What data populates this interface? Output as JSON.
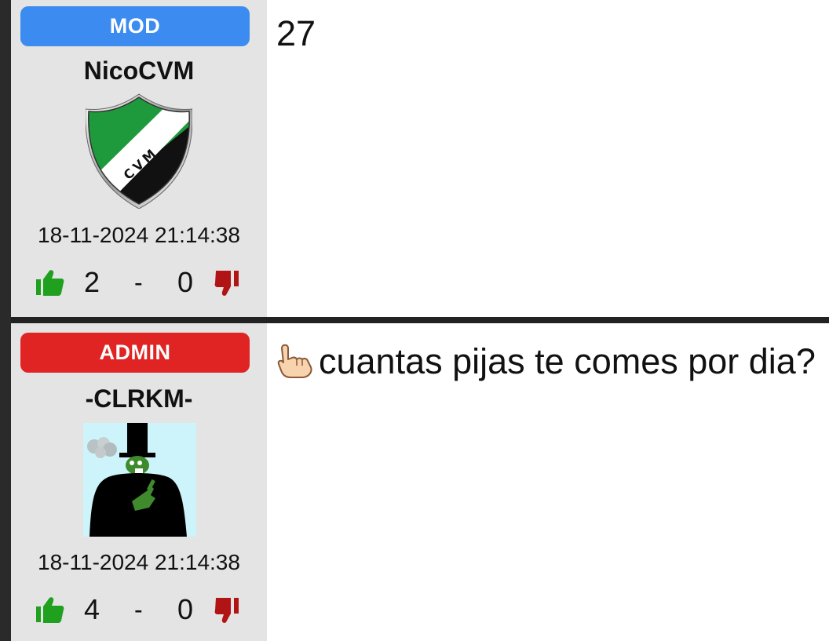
{
  "posts": [
    {
      "role": "MOD",
      "role_color": "#3b8bf0",
      "username": "NicoCVM",
      "avatar_icon": "cvm-club-shield-icon",
      "avatar_text": "CVM",
      "timestamp": "18-11-2024 21:14:38",
      "upvotes": "2",
      "separator": "-",
      "downvotes": "0",
      "message": "27"
    },
    {
      "role": "ADMIN",
      "role_color": "#e02424",
      "username": "-CLRKM-",
      "avatar_icon": "pepe-top-hat-middle-finger-icon",
      "timestamp": "18-11-2024 21:14:38",
      "upvotes": "4",
      "separator": "-",
      "downvotes": "0",
      "message_icon": "pointing-hand-up-emoji",
      "message": "cuantas pijas te comes por dia?"
    }
  ],
  "colors": {
    "panel_bg": "#e4e4e4",
    "upvote_green": "#1fa01f",
    "downvote_red": "#b01414"
  }
}
